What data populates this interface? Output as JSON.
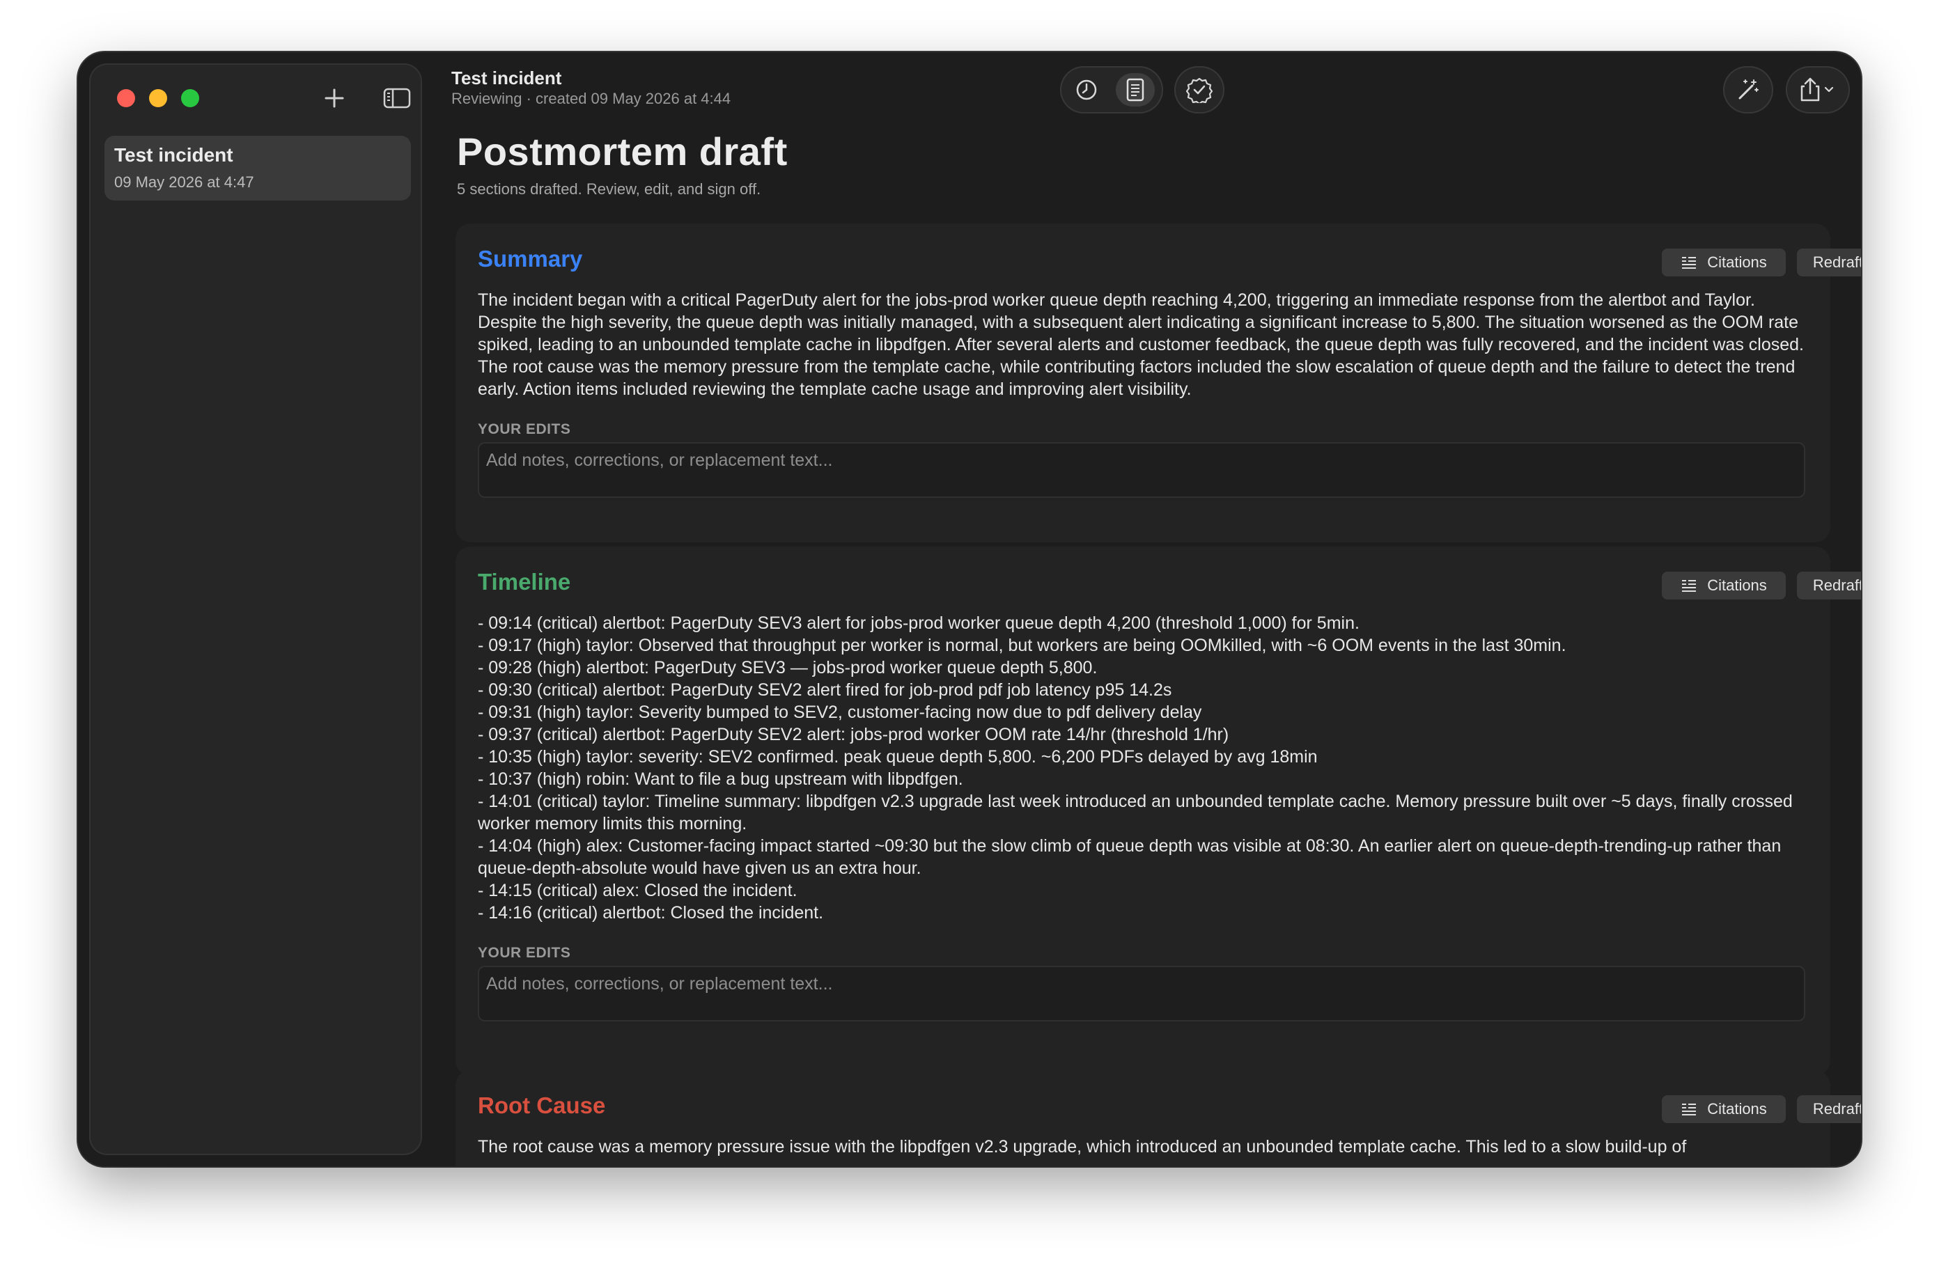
{
  "window": {
    "sidebar": {
      "item": {
        "title": "Test incident",
        "date": "09 May 2026 at 4:47"
      }
    },
    "header": {
      "title": "Test incident",
      "subtitle": "Reviewing · created 09 May 2026 at 4:44"
    },
    "icons": {
      "history": "clock-icon",
      "draft": "document-icon",
      "verify": "checkmark-seal-icon",
      "magic": "magic-wand-icon",
      "share": "share-icon"
    }
  },
  "main": {
    "title": "Postmortem draft",
    "subtitle": "5 sections drafted. Review, edit, and sign off.",
    "buttons": {
      "citations": "Citations",
      "redraft": "Redraft"
    },
    "edits_label": "YOUR EDITS",
    "edits_placeholder": "Add notes, corrections, or replacement text...",
    "sections": [
      {
        "title": "Summary",
        "color": "#3b82f6",
        "body": "The incident began with a critical PagerDuty alert for the jobs-prod worker queue depth reaching 4,200, triggering an immediate response from the alertbot and Taylor. Despite the high severity, the queue depth was initially managed, with a subsequent alert indicating a significant increase to 5,800. The situation worsened as the OOM rate spiked, leading to an unbounded template cache in libpdfgen. After several alerts and customer feedback, the queue depth was fully recovered, and the incident was closed. The root cause was the memory pressure from the template cache, while contributing factors included the slow escalation of queue depth and the failure to detect the trend early. Action items included reviewing the template cache usage and improving alert visibility."
      },
      {
        "title": "Timeline",
        "color": "#4aa96c",
        "lines": [
          "- 09:14 (critical) alertbot: PagerDuty SEV3 alert for jobs-prod worker queue depth 4,200 (threshold 1,000) for 5min.",
          "- 09:17 (high) taylor: Observed that throughput per worker is normal, but workers are being OOMkilled, with ~6 OOM events in the last 30min.",
          "- 09:28 (high) alertbot: PagerDuty SEV3 — jobs-prod worker queue depth 5,800.",
          "- 09:30 (critical) alertbot: PagerDuty SEV2 alert fired for job-prod pdf job latency p95 14.2s",
          "- 09:31 (high) taylor: Severity bumped to SEV2, customer-facing now due to pdf delivery delay",
          "- 09:37 (critical) alertbot: PagerDuty SEV2 alert: jobs-prod worker OOM rate 14/hr (threshold 1/hr)",
          "- 10:35 (high) taylor: severity: SEV2 confirmed. peak queue depth 5,800. ~6,200 PDFs delayed by avg 18min",
          "- 10:37 (high) robin: Want to file a bug upstream with libpdfgen.",
          "- 14:01 (critical) taylor: Timeline summary: libpdfgen v2.3 upgrade last week introduced an unbounded template cache. Memory pressure built over ~5 days, finally crossed worker memory limits this morning.",
          "- 14:04 (high) alex: Customer-facing impact started ~09:30 but the slow climb of queue depth was visible at 08:30. An earlier alert on queue-depth-trending-up rather than queue-depth-absolute would have given us an extra hour.",
          "- 14:15 (critical) alex: Closed the incident.",
          "- 14:16 (critical) alertbot: Closed the incident."
        ]
      },
      {
        "title": "Root Cause",
        "color": "#d9503f",
        "body": "The root cause was a memory pressure issue with the libpdfgen v2.3 upgrade, which introduced an unbounded template cache. This led to a slow build-up of"
      }
    ]
  }
}
